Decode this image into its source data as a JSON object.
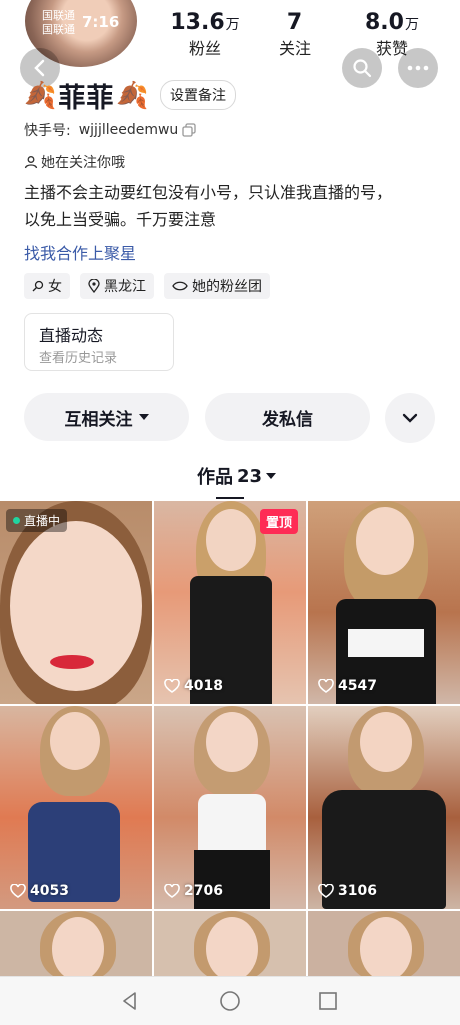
{
  "status": {
    "carrier1": "国联通",
    "carrier2": "国联通",
    "time": "7:16"
  },
  "stats": [
    {
      "num": "13.6",
      "unit": "万",
      "label": "粉丝"
    },
    {
      "num": "7",
      "unit": "",
      "label": "关注"
    },
    {
      "num": "8.0",
      "unit": "万",
      "label": "获赞"
    }
  ],
  "profile": {
    "name": "菲菲",
    "remark_button": "设置备注",
    "id_label": "快手号:",
    "id_value": "wjjjlleedemwu",
    "follows_you": "她在关注你哦",
    "bio_line1": "主播不会主动要红包没有小号，只认准我直播的号，",
    "bio_line2": "以免上当受骗。千万要注意",
    "link": "找我合作上聚星"
  },
  "tags": [
    {
      "icon": "gender-icon",
      "label": "女"
    },
    {
      "icon": "location-icon",
      "label": "黑龙江"
    },
    {
      "icon": "fan-group-icon",
      "label": "她的粉丝团"
    }
  ],
  "live_card": {
    "title": "直播动态",
    "subtitle": "查看历史记录"
  },
  "actions": {
    "mutual": "互相关注",
    "message": "发私信"
  },
  "tab": {
    "label": "作品",
    "count": "23"
  },
  "videos": [
    {
      "badge": "直播中",
      "likes": ""
    },
    {
      "badge": "置顶",
      "likes": "4018"
    },
    {
      "badge": "",
      "likes": "4547"
    },
    {
      "badge": "",
      "likes": "4053"
    },
    {
      "badge": "",
      "likes": "2706"
    },
    {
      "badge": "",
      "likes": "3106"
    }
  ],
  "colors": {
    "accent": "#fe2c55",
    "live": "#20d5a0",
    "link": "#3b5ba8"
  }
}
